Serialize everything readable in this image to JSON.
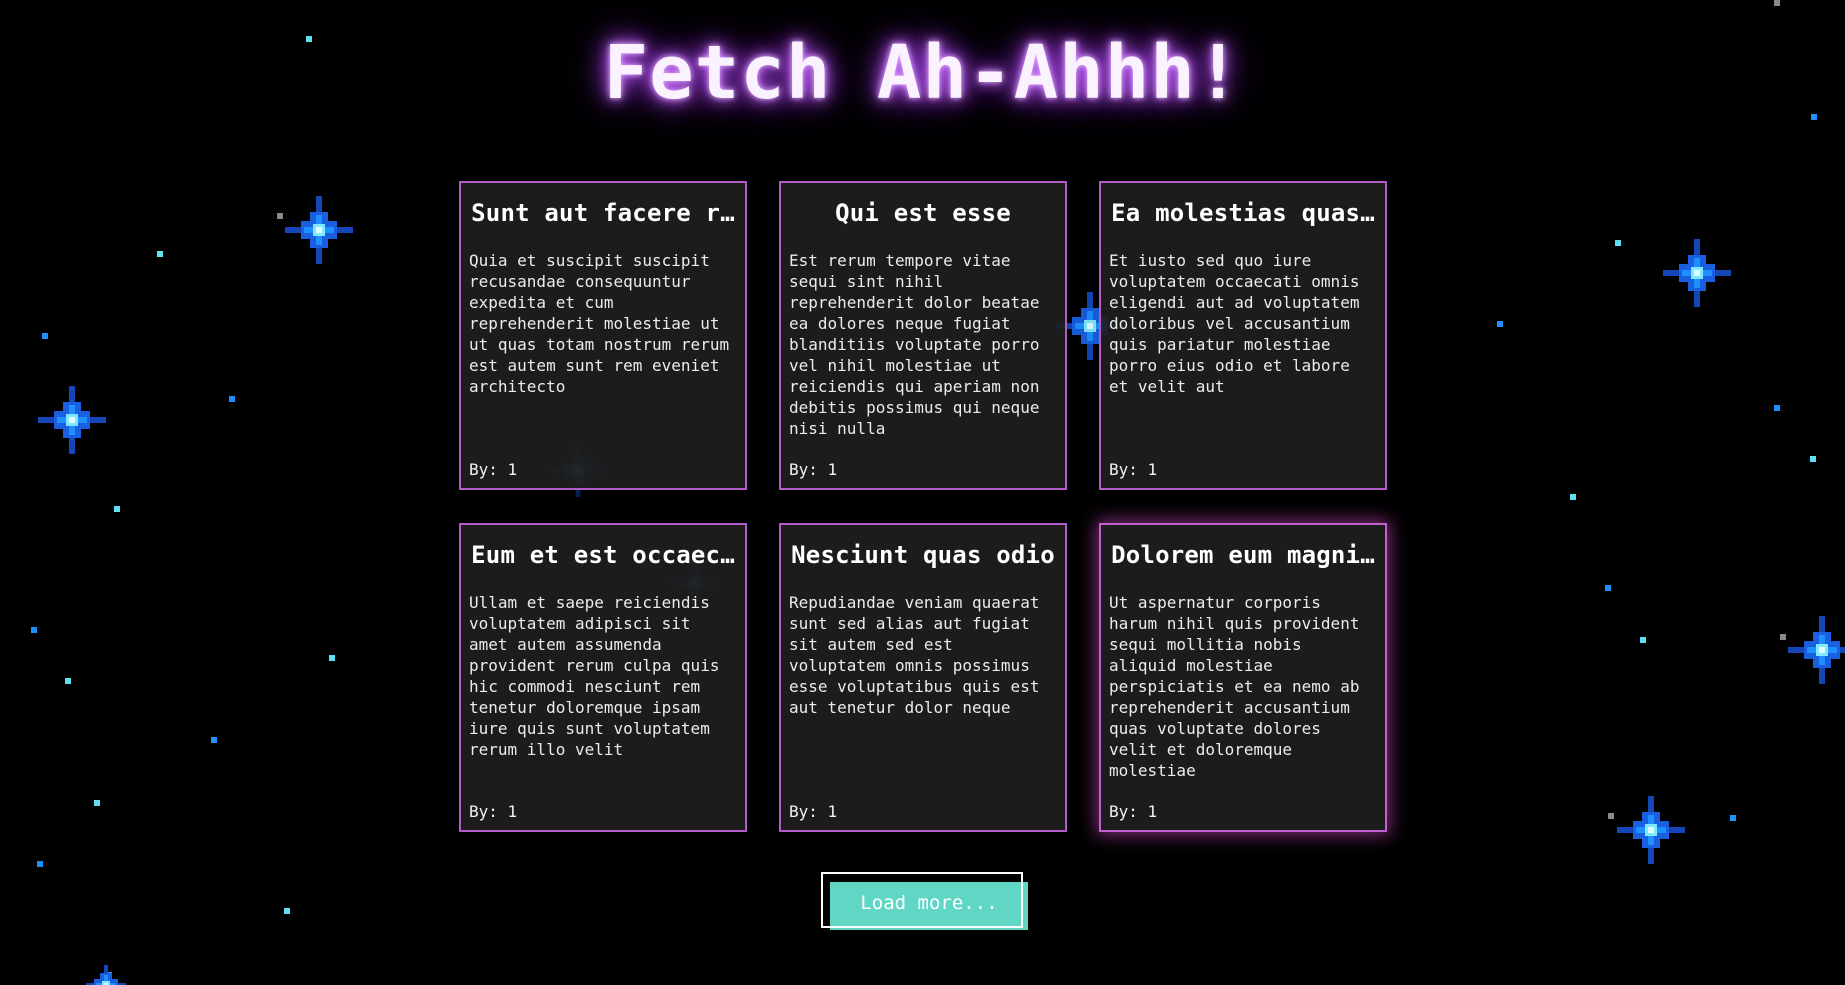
{
  "header": {
    "title": "Fetch Ah-Ahhh!"
  },
  "posts": [
    {
      "title": "Sunt aut facere r…",
      "body": "Quia et suscipit suscipit recusandae consequuntur expedita et cum reprehenderit molestiae ut ut quas totam nostrum rerum est autem sunt rem eveniet architecto",
      "author": "By: 1"
    },
    {
      "title": "Qui est esse",
      "body": "Est rerum tempore vitae sequi sint nihil reprehenderit dolor beatae ea dolores neque fugiat blanditiis voluptate porro vel nihil molestiae ut reiciendis qui aperiam non debitis possimus qui neque nisi nulla",
      "author": "By: 1"
    },
    {
      "title": "Ea molestias quas…",
      "body": "Et iusto sed quo iure voluptatem occaecati omnis eligendi aut ad voluptatem doloribus vel accusantium quis pariatur molestiae porro eius odio et labore et velit aut",
      "author": "By: 1"
    },
    {
      "title": "Eum et est occaec…",
      "body": "Ullam et saepe reiciendis voluptatem adipisci sit amet autem assumenda provident rerum culpa quis hic commodi nesciunt rem tenetur doloremque ipsam iure quis sunt voluptatem rerum illo velit",
      "author": "By: 1"
    },
    {
      "title": "Nesciunt quas odio",
      "body": "Repudiandae veniam quaerat sunt sed alias aut fugiat sit autem sed est voluptatem omnis possimus esse voluptatibus quis est aut tenetur dolor neque",
      "author": "By: 1"
    },
    {
      "title": "Dolorem eum magni…",
      "body": "Ut aspernatur corporis harum nihil quis provident sequi mollitia nobis aliquid molestiae perspiciatis et ea nemo ab reprehenderit accusantium quas voluptate dolores velit et doloremque molestiae",
      "author": "By: 1"
    }
  ],
  "load_more": {
    "label": "Load more..."
  },
  "colors": {
    "background": "#000000",
    "card_border": "#b25bc9",
    "card_background": "#1e1e1e",
    "title_glow": "#c66cff",
    "button": "#5fd7c4",
    "star_bright": "#1e90ff",
    "star_core": "#dfffff",
    "star_dot": "#5ee0f0"
  }
}
